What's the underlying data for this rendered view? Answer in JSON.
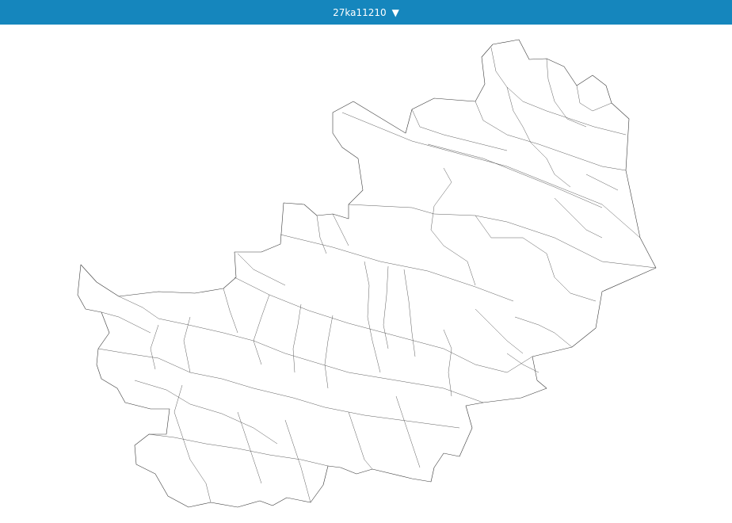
{
  "header": {
    "title": "27ka11210",
    "dropdown_icon": "triangle-down-icon"
  },
  "map": {
    "background": "#ffffff",
    "stroke": "#3a3a3a",
    "bar_color": "#1586bd"
  }
}
